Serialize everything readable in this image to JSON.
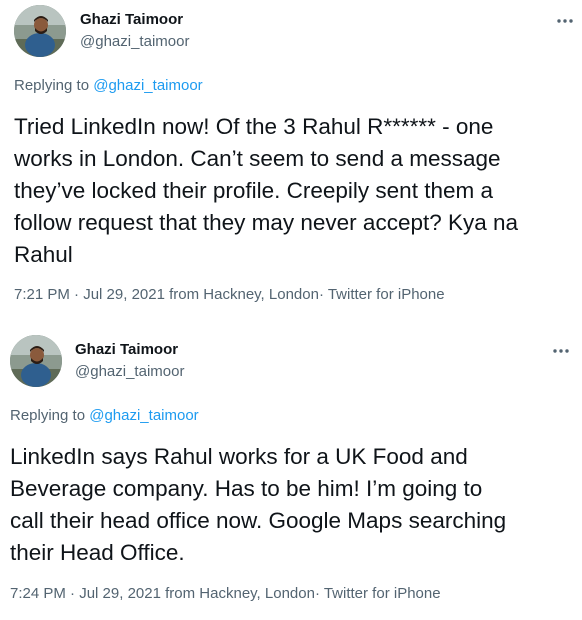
{
  "tweets": [
    {
      "display_name": "Ghazi Taimoor",
      "handle": "@ghazi_taimoor",
      "more_icon": "more-horizontal-icon",
      "replying_prefix": "Replying to",
      "replying_to": "@ghazi_taimoor",
      "text_lines": [
        "Tried LinkedIn now! Of the 3 Rahul R****** - one",
        "works in London. Can’t seem to send a message",
        "they’ve locked their profile. Creepily sent them a",
        "follow request that they may never accept? Kya na",
        "Rahul"
      ],
      "time": "7:21 PM",
      "date": "Jul 29, 2021",
      "location_prefix": "from",
      "location": "Hackney, London",
      "source": "Twitter for iPhone"
    },
    {
      "display_name": "Ghazi Taimoor",
      "handle": "@ghazi_taimoor",
      "more_icon": "more-horizontal-icon",
      "replying_prefix": "Replying to",
      "replying_to": "@ghazi_taimoor",
      "text_lines": [
        "LinkedIn says Rahul works for a UK Food and",
        "Beverage company. Has to be him! I’m going to",
        "call their head office now. Google Maps searching",
        "their Head Office."
      ],
      "time": "7:24 PM",
      "date": "Jul 29, 2021",
      "location_prefix": "from",
      "location": "Hackney, London",
      "source": "Twitter for iPhone"
    }
  ],
  "colors": {
    "text": "#0f1419",
    "secondary": "#536471",
    "link": "#1d9bf0"
  },
  "separator": "·"
}
